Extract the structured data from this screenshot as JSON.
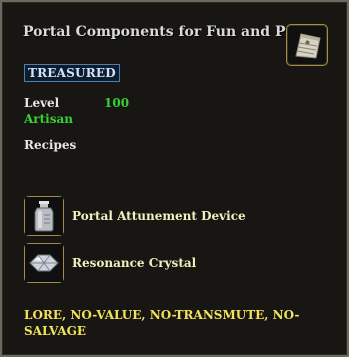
{
  "item": {
    "title": "Portal Components for Fun and Profit",
    "icon": "parchment-scroll-icon",
    "badge": "TREASURED"
  },
  "stats": {
    "level_label": "Level",
    "level_value": "100",
    "class_label": "Artisan",
    "recipes_label": "Recipes"
  },
  "recipes": [
    {
      "label": "Portal Attunement Device",
      "icon": "silver-flask-icon"
    },
    {
      "label": "Resonance Crystal",
      "icon": "crystal-gem-icon"
    }
  ],
  "flags": "LORE, NO-VALUE, NO-TRANSMUTE, NO-SALVAGE",
  "colors": {
    "background": "#171613",
    "border": "#6b6a5c",
    "title": "#d9d9d9",
    "level_value": "#38d238",
    "artisan": "#38d238",
    "recipe_text": "#f1f0c0",
    "flags": "#f2e25b",
    "badge_border": "#4c7fb3"
  }
}
